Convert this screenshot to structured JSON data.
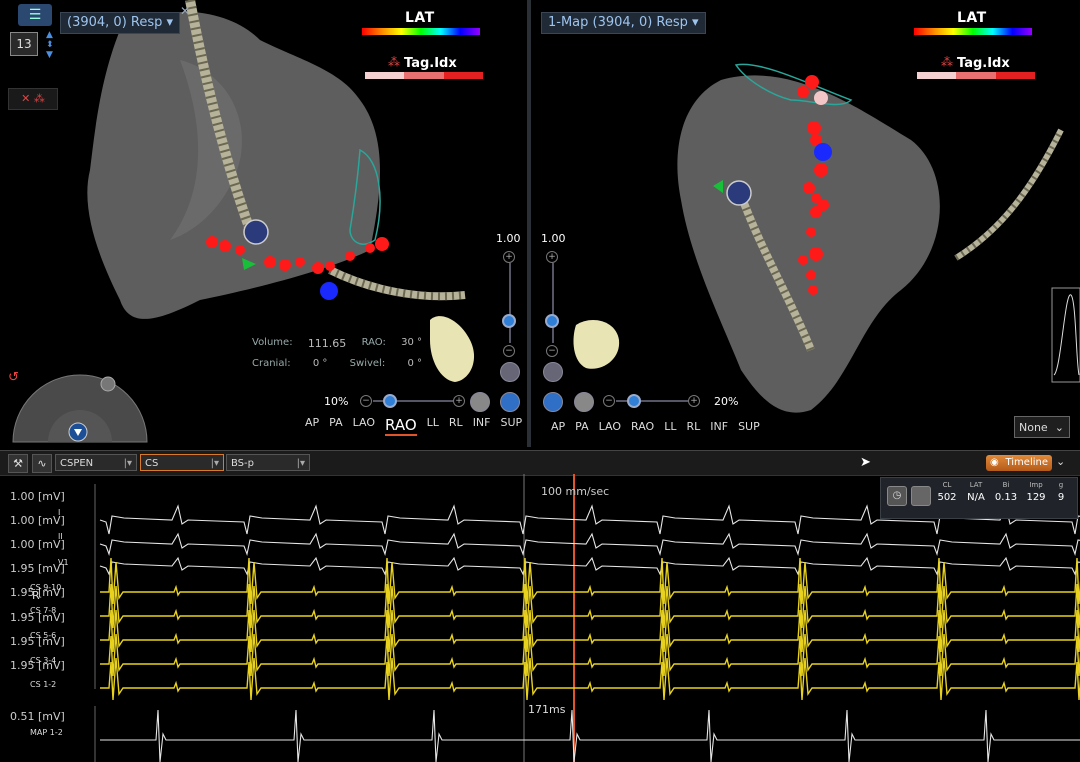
{
  "left_panel": {
    "title": "(3904, 0) Resp",
    "frame_number": "13",
    "lat_label": "LAT",
    "tag_label": "Tag.Idx",
    "volume_label": "Volume:",
    "volume_value": "111.65",
    "projection_label": "RAO:",
    "projection_value": "30 °",
    "cranial_label": "Cranial:",
    "cranial_value": "0 °",
    "swivel_label": "Swivel:",
    "swivel_value": "0 °",
    "scale_value": "1.00",
    "transparency": "10%",
    "views": [
      "AP",
      "PA",
      "LAO",
      "RAO",
      "LL",
      "RL",
      "INF",
      "SUP"
    ],
    "selected_view": "RAO"
  },
  "right_panel": {
    "title": "1-Map (3904, 0) Resp",
    "lat_label": "LAT",
    "tag_label": "Tag.Idx",
    "scale_value": "1.00",
    "transparency": "20%",
    "views": [
      "AP",
      "PA",
      "LAO",
      "RAO",
      "LL",
      "RL",
      "INF",
      "SUP"
    ],
    "none_select": "None"
  },
  "toolbar": {
    "select1": "CSPEN",
    "select2": "CS",
    "select3": "BS-p",
    "timeline_label": "Timeline"
  },
  "measurements": {
    "headers": [
      "CL",
      "LAT",
      "Bi",
      "Imp",
      "g"
    ],
    "values": [
      "502",
      "N/A",
      "0.13",
      "129",
      "9"
    ]
  },
  "ecg": {
    "speed": "100 mm/sec",
    "interval": "171ms",
    "scales": [
      "1.00 [mV]",
      "1.00 [mV]",
      "1.00 [mV]",
      "1.95 [mV]",
      "1.95 [mV]",
      "1.95 [mV]",
      "1.95 [mV]",
      "1.95 [mV]",
      "0.51 [mV]"
    ],
    "channels": [
      "I",
      "II",
      "V1",
      "CS 9-10",
      "CS 7-8",
      "CS 5-6",
      "CS 3-4",
      "CS 1-2",
      "MAP 1-2"
    ],
    "marker": "R"
  },
  "colors": {
    "ecg_white": "#e6e6e6",
    "ecg_yellow": "#e8d21e",
    "marker_red": "#e0552a",
    "tag_point": "#ff1a1a",
    "ablation_blue": "#1a2aff"
  }
}
